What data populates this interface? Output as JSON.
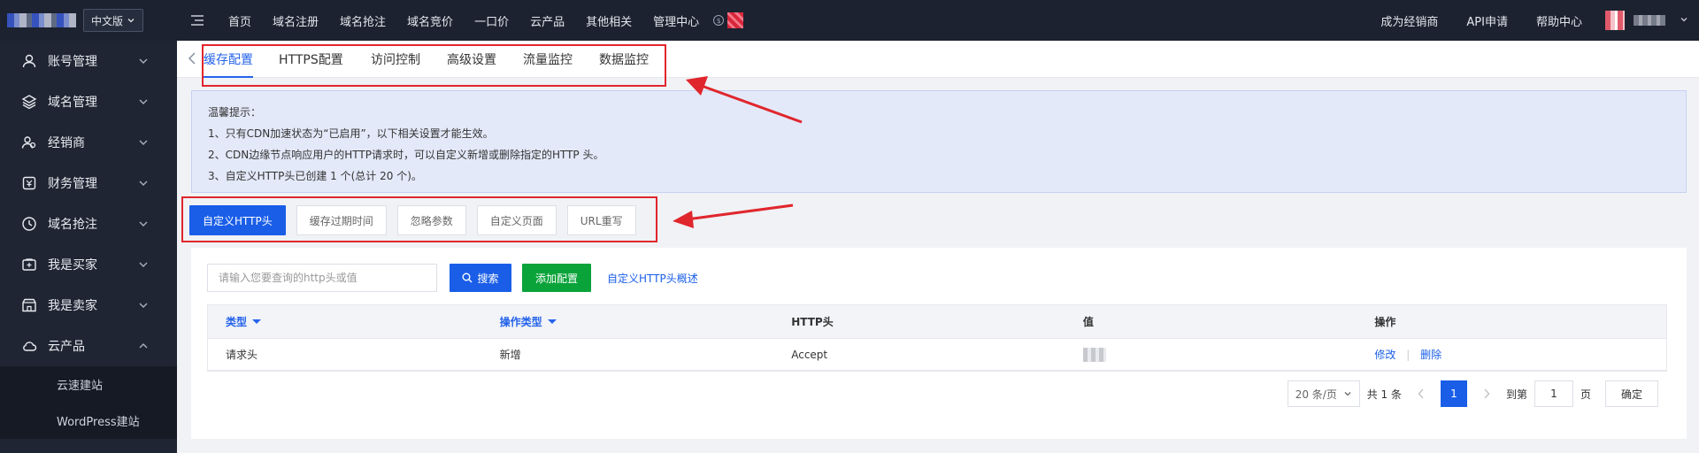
{
  "header": {
    "lang": "中文版",
    "menu_items": [
      "首页",
      "域名注册",
      "域名抢注",
      "域名竞价",
      "一口价",
      "云产品",
      "其他相关",
      "管理中心"
    ],
    "right_items": [
      "成为经销商",
      "API申请",
      "帮助中心"
    ]
  },
  "sidebar": {
    "items": [
      {
        "label": "账号管理",
        "icon": "user-icon"
      },
      {
        "label": "域名管理",
        "icon": "layers-icon"
      },
      {
        "label": "经销商",
        "icon": "users-icon"
      },
      {
        "label": "财务管理",
        "icon": "finance-icon"
      },
      {
        "label": "域名抢注",
        "icon": "clock-icon"
      },
      {
        "label": "我是买家",
        "icon": "cart-icon"
      },
      {
        "label": "我是卖家",
        "icon": "store-icon"
      },
      {
        "label": "云产品",
        "icon": "cloud-icon"
      }
    ],
    "sub_items": [
      "云速建站",
      "WordPress建站"
    ]
  },
  "tabs": [
    "缓存配置",
    "HTTPS配置",
    "访问控制",
    "高级设置",
    "流量监控",
    "数据监控"
  ],
  "notice": {
    "title": "温馨提示：",
    "lines": [
      "1、只有CDN加速状态为“已启用”，以下相关设置才能生效。",
      "2、CDN边缘节点响应用户的HTTP请求时，可以自定义新增或删除指定的HTTP 头。",
      "3、自定义HTTP头已创建 1 个(总计 20 个)。"
    ]
  },
  "subtabs": [
    "自定义HTTP头",
    "缓存过期时间",
    "忽略参数",
    "自定义页面",
    "URL重写"
  ],
  "toolbar": {
    "search_placeholder": "请输入您要查询的http头或值",
    "search_label": "搜索",
    "add_label": "添加配置",
    "doc_link": "自定义HTTP头概述"
  },
  "table": {
    "headers": [
      "类型",
      "操作类型",
      "HTTP头",
      "值",
      "操作"
    ],
    "rows": [
      {
        "type": "请求头",
        "op_type": "新增",
        "http_header": "Accept",
        "edit": "修改",
        "delete": "删除"
      }
    ]
  },
  "pagination": {
    "page_size": "20 条/页",
    "total": "共 1 条",
    "current": "1",
    "goto_label": "到第",
    "goto_value": "1",
    "page_unit": "页",
    "confirm": "确定"
  },
  "colors": {
    "accent": "#1a5ee8",
    "success": "#0aa33a",
    "annotation": "#e0262d",
    "navbar": "#1c2230"
  }
}
